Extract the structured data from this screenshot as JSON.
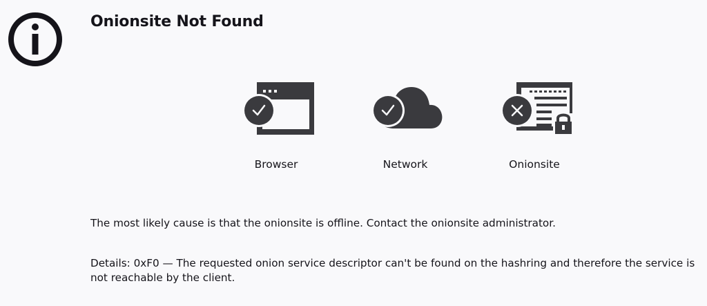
{
  "page": {
    "title": "Onionsite Not Found"
  },
  "status": {
    "items": [
      {
        "label": "Browser",
        "icon": "browser-window-icon",
        "state": "ok"
      },
      {
        "label": "Network",
        "icon": "cloud-icon",
        "state": "ok"
      },
      {
        "label": "Onionsite",
        "icon": "onionsite-icon",
        "state": "error"
      }
    ]
  },
  "messages": {
    "cause": "The most likely cause is that the onionsite is offline. Contact the onionsite administrator.",
    "details": "Details: 0xF0 — The requested onion service descriptor can't be found on the hashring and therefore the service is not reachable by the client."
  },
  "colors": {
    "background": "#f9f9fb",
    "text": "#15141a",
    "icon": "#3a3a3e",
    "badge": "#3a3a3e"
  }
}
